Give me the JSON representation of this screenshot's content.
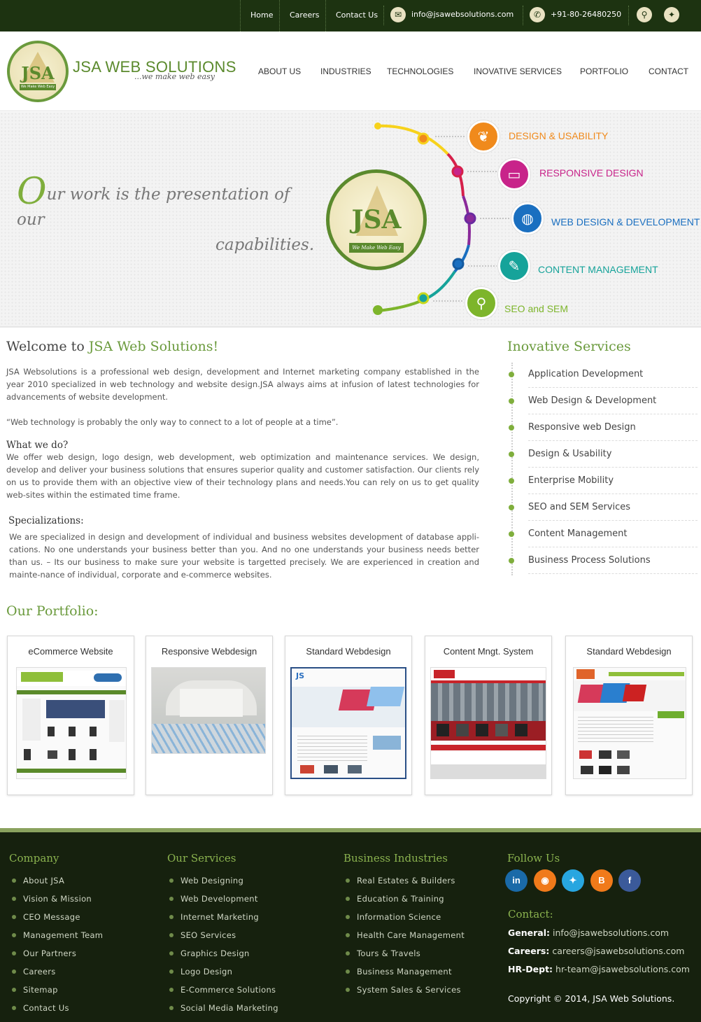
{
  "topbar": {
    "links": [
      "Home",
      "Careers",
      "Contact Us"
    ],
    "email": "info@jsawebsolutions.com",
    "phone": "+91-80-26480250",
    "email_icon": "mail-icon",
    "phone_icon": "phone-icon"
  },
  "header": {
    "logo_monogram": "JSA",
    "logo_tag": "We Make Web Easy",
    "brand": "JSA WEB SOLUTIONS",
    "brand_sub": "...we make web easy",
    "nav": [
      "ABOUT US",
      "INDUSTRIES",
      "TECHNOLOGIES",
      "INOVATIVE SERVICES",
      "PORTFOLIO",
      "CONTACT"
    ]
  },
  "hero": {
    "tagline_first_letter": "O",
    "tagline_rest": "ur work is the presentation of our",
    "tagline_line2": "capabilities.",
    "seal_monogram": "JSA",
    "seal_tag": "We Make Web Easy",
    "services": [
      {
        "label": "DESIGN & USABILITY",
        "color": "#f08a1c"
      },
      {
        "label": "RESPONSIVE DESIGN",
        "color": "#c8248a"
      },
      {
        "label": "WEB DESIGN & DEVELOPMENT",
        "color": "#1a6fc0"
      },
      {
        "label": "CONTENT MANAGEMENT",
        "color": "#16a39a"
      },
      {
        "label": "SEO and SEM",
        "color": "#7db52b"
      }
    ]
  },
  "welcome": {
    "title_prefix": "Welcome to ",
    "title_brand": "JSA Web Solutions!",
    "intro": "JSA Websolutions is a professional web design, development and Internet marketing company established in the year 2010 specialized in web technology and website design.JSA always aims at infusion of latest technologies for advancements of website development.",
    "quote": "“Web technology is probably the only way to connect to a lot of people at a time”.",
    "what_title": "What we do?",
    "what_text": "We offer web design, logo design, web development, web optimization and maintenance services. We design, develop and deliver your business solutions that ensures superior quality and customer satisfaction. Our clients rely on us to provide them with an objective view of their technology plans and needs.You can rely on us to get quality web-sites within the estimated time frame.",
    "spec_title": "Specializations:",
    "spec_text": "We are specialized in design and development of individual and business websites development of database appli-cations. No one understands your business better than you. And no one understands your business needs better than us. – Its our business to make sure your website is targetted precisely. We are experienced in creation and mainte-nance of individual, corporate and e-commerce websites."
  },
  "sidebar": {
    "title": "Inovative Services",
    "items": [
      "Application Development",
      "Web Design & Development",
      "Responsive web Design",
      "Design & Usability",
      "Enterprise Mobility",
      "SEO and SEM Services",
      "Content Management",
      "Business Process Solutions"
    ]
  },
  "portfolio": {
    "title": "Our Portfolio:",
    "items": [
      "eCommerce Website",
      "Responsive Webdesign",
      "Standard Webdesign",
      "Content Mngt. System",
      "Standard Webdesign"
    ]
  },
  "footer": {
    "company_title": "Company",
    "company": [
      "About JSA",
      "Vision & Mission",
      "CEO Message",
      "Management Team",
      "Our Partners",
      "Careers",
      "Sitemap",
      "Contact Us"
    ],
    "services_title": "Our Services",
    "services": [
      "Web Designing",
      "Web Development",
      "Internet Marketing",
      "SEO Services",
      "Graphics Design",
      "Logo Design",
      "E-Commerce Solutions",
      "Social Media Marketing"
    ],
    "industries_title": "Business Industries",
    "industries": [
      "Real Estates & Builders",
      "Education & Training",
      "Information Science",
      "Health Care Management",
      "Tours & Travels",
      "Business Management",
      "System Sales & Services"
    ],
    "follow_title": "Follow Us",
    "social": [
      {
        "name": "linkedin-icon",
        "glyph": "in",
        "color": "#1a6aa8"
      },
      {
        "name": "rss-icon",
        "glyph": "◉",
        "color": "#f07a1a"
      },
      {
        "name": "twitter-icon",
        "glyph": "✦",
        "color": "#28a6e0"
      },
      {
        "name": "blogger-icon",
        "glyph": "B",
        "color": "#f07a1a"
      },
      {
        "name": "facebook-icon",
        "glyph": "f",
        "color": "#3b5a9a"
      }
    ],
    "contact_title": "Contact:",
    "general_label": "General:",
    "general_email": "info@jsawebsolutions.com",
    "careers_label": "Careers:",
    "careers_email": "careers@jsawebsolutions.com",
    "hr_label": "HR-Dept:",
    "hr_email": "hr-team@jsawebsolutions.com",
    "copyright": "Copyright © 2014, JSA Web Solutions."
  }
}
